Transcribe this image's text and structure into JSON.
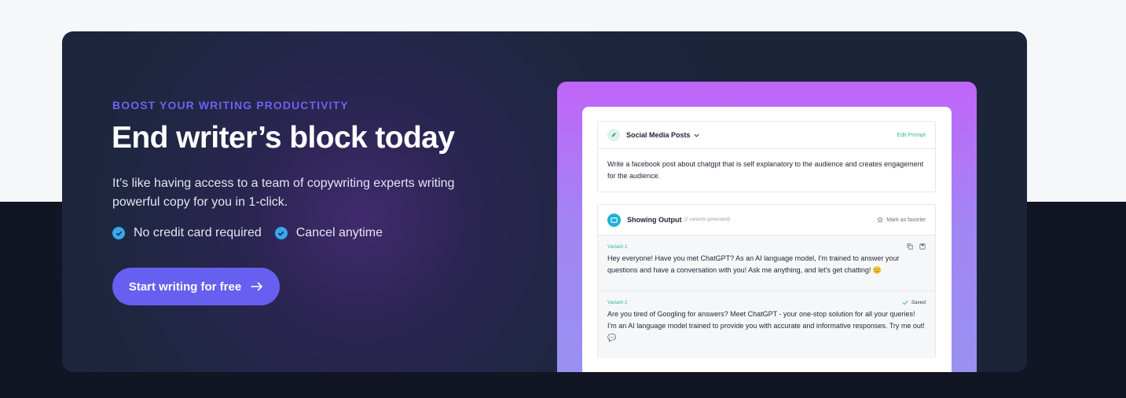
{
  "hero": {
    "eyebrow": "BOOST YOUR WRITING PRODUCTIVITY",
    "headline": "End writer’s block today",
    "description": "It’s like having access to a team of copywriting experts writing powerful copy for you in 1-click.",
    "checks": [
      "No credit card required",
      "Cancel anytime"
    ],
    "cta_label": "Start writing for free"
  },
  "mock": {
    "template_name": "Social Media Posts",
    "edit_prompt": "Edit Prompt",
    "prompt_text": "Write a facebook post about chatgpt that is self explanatory to the audience and creates engagement for the audience.",
    "output_title": "Showing Output",
    "variants_generated": "(2 variants generated)",
    "mark_favorite": "Mark as favorite",
    "variants": [
      {
        "label": "Variant 1",
        "text": "Hey everyone! Have you met ChatGPT? As an AI language model, I'm trained to answer your questions and have a conversation with you! Ask me anything, and let's get chatting! 😊"
      },
      {
        "label": "Variant 2",
        "status": "Saved",
        "text": "Are you tired of Googling for answers? Meet ChatGPT - your one-stop solution for all your queries! I'm an AI language model trained to provide you with accurate and informative responses. Try me out! 💬"
      }
    ]
  },
  "colors": {
    "accent": "#675ff0",
    "eyebrow": "#6b63f0",
    "check": "#38a8ec",
    "green": "#3bb78e",
    "card_bg": "#1c2439"
  }
}
